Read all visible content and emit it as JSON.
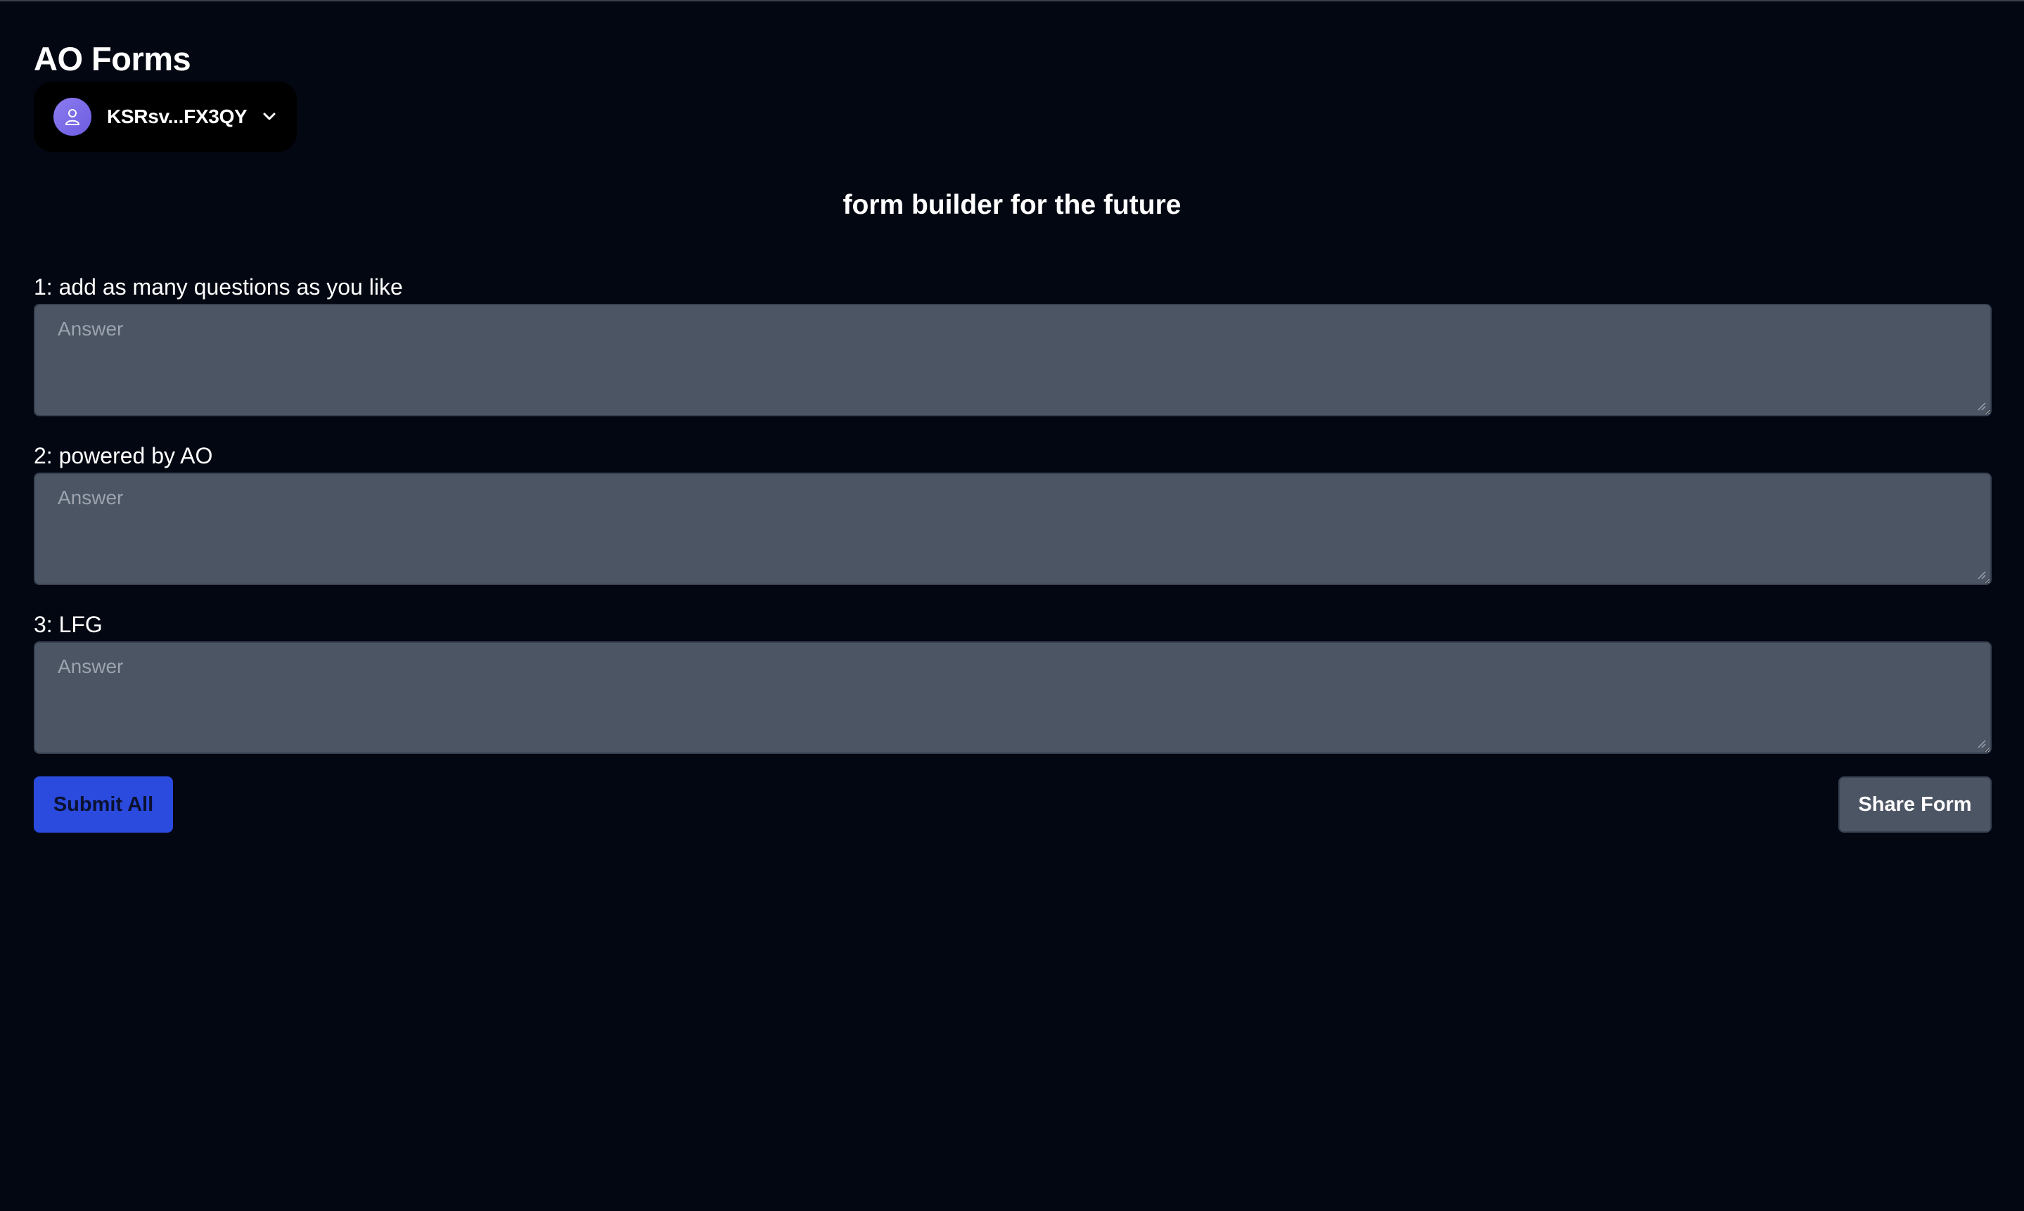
{
  "app": {
    "title": "AO Forms"
  },
  "wallet": {
    "address": "KSRsv...FX3QY",
    "avatar_icon": "user-icon",
    "dropdown_icon": "chevron-down-icon",
    "avatar_color": "#7b6ae8"
  },
  "form": {
    "subtitle": "form builder for the future",
    "questions": [
      {
        "label": "1: add as many questions as you like",
        "placeholder": "Answer",
        "value": ""
      },
      {
        "label": "2: powered by AO",
        "placeholder": "Answer",
        "value": ""
      },
      {
        "label": "3: LFG",
        "placeholder": "Answer",
        "value": ""
      }
    ],
    "submit_label": "Submit All",
    "share_label": "Share Form"
  },
  "colors": {
    "background": "#030712",
    "input_background": "#4b5563",
    "submit_button": "#2b4ade",
    "share_button": "#4b5563"
  }
}
